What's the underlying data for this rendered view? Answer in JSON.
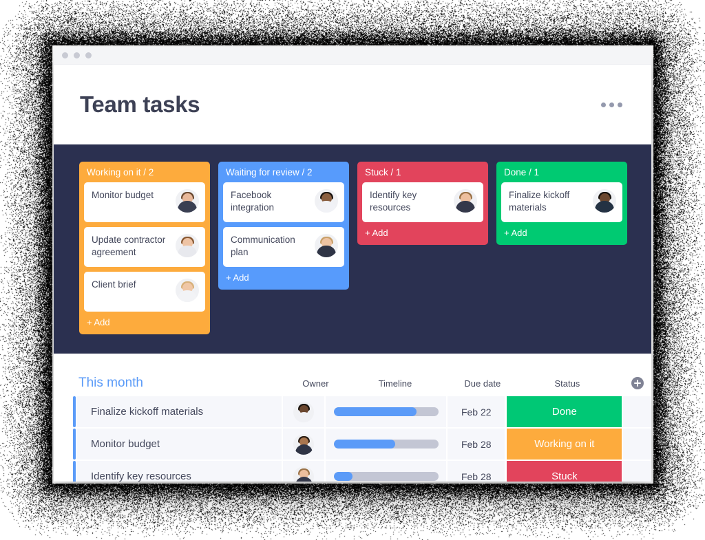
{
  "window": {
    "traffic_lights": [
      "dot",
      "dot",
      "dot"
    ]
  },
  "header": {
    "title": "Team tasks",
    "menu_icon": "ellipsis-icon"
  },
  "board": {
    "background_color": "#2b3050",
    "columns": [
      {
        "title": "Working on it / 2",
        "color": "#fdab3d",
        "add_label": "+ Add",
        "cards": [
          {
            "text": "Monitor budget",
            "avatar": {
              "skin": "#e8b89a",
              "hair": "#6b4a32",
              "shirt": "#3a3f52"
            }
          },
          {
            "text": "Update contractor agreement",
            "avatar": {
              "skin": "#eec3a4",
              "hair": "#8a5a34",
              "shirt": "#e8e9ee"
            }
          },
          {
            "text": "Client brief",
            "avatar": {
              "skin": "#f0c7a6",
              "hair": "#d7b07a",
              "shirt": "#f2f3f6"
            }
          }
        ]
      },
      {
        "title": "Waiting for review / 2",
        "color": "#579bfc",
        "add_label": "+ Add",
        "cards": [
          {
            "text": "Facebook integration",
            "avatar": {
              "skin": "#8a5f40",
              "hair": "#1d1712",
              "shirt": "#f1f2f6"
            }
          },
          {
            "text": "Communication plan",
            "avatar": {
              "skin": "#edc3a2",
              "hair": "#c9a06a",
              "shirt": "#2f3445"
            }
          }
        ]
      },
      {
        "title": "Stuck / 1",
        "color": "#e2445c",
        "add_label": "+ Add",
        "cards": [
          {
            "text": "Identify key resources",
            "avatar": {
              "skin": "#edbf9e",
              "hair": "#9a7247",
              "shirt": "#34384a"
            }
          }
        ]
      },
      {
        "title": "Done / 1",
        "color": "#00ca72",
        "add_label": "+ Add",
        "cards": [
          {
            "text": "Finalize kickoff materials",
            "avatar": {
              "skin": "#6b472f",
              "hair": "#17120e",
              "shirt": "#243243"
            }
          }
        ]
      }
    ]
  },
  "table": {
    "group_title": "This month",
    "columns": [
      "Owner",
      "Timeline",
      "Due date",
      "Status"
    ],
    "add_column_icon": "plus-circle-icon",
    "accent_color": "#5b9bf8",
    "rows": [
      {
        "name": "Finalize kickoff materials",
        "owner_avatar": {
          "skin": "#6b472f",
          "hair": "#17120e",
          "shirt": "#f0f1f5"
        },
        "timeline_percent": 79,
        "due_date": "Feb 22",
        "status": "Done",
        "status_color": "#00c875"
      },
      {
        "name": "Monitor budget",
        "owner_avatar": {
          "skin": "#a9764f",
          "hair": "#2a1d14",
          "shirt": "#2f3445"
        },
        "timeline_percent": 59,
        "due_date": "Feb 28",
        "status": "Working on it",
        "status_color": "#fdab3d"
      },
      {
        "name": "Identify key resources",
        "owner_avatar": {
          "skin": "#edbf9e",
          "hair": "#9a7247",
          "shirt": "#34384a"
        },
        "timeline_percent": 18,
        "due_date": "Feb 28",
        "status": "Stuck",
        "status_color": "#e2445c"
      }
    ]
  }
}
